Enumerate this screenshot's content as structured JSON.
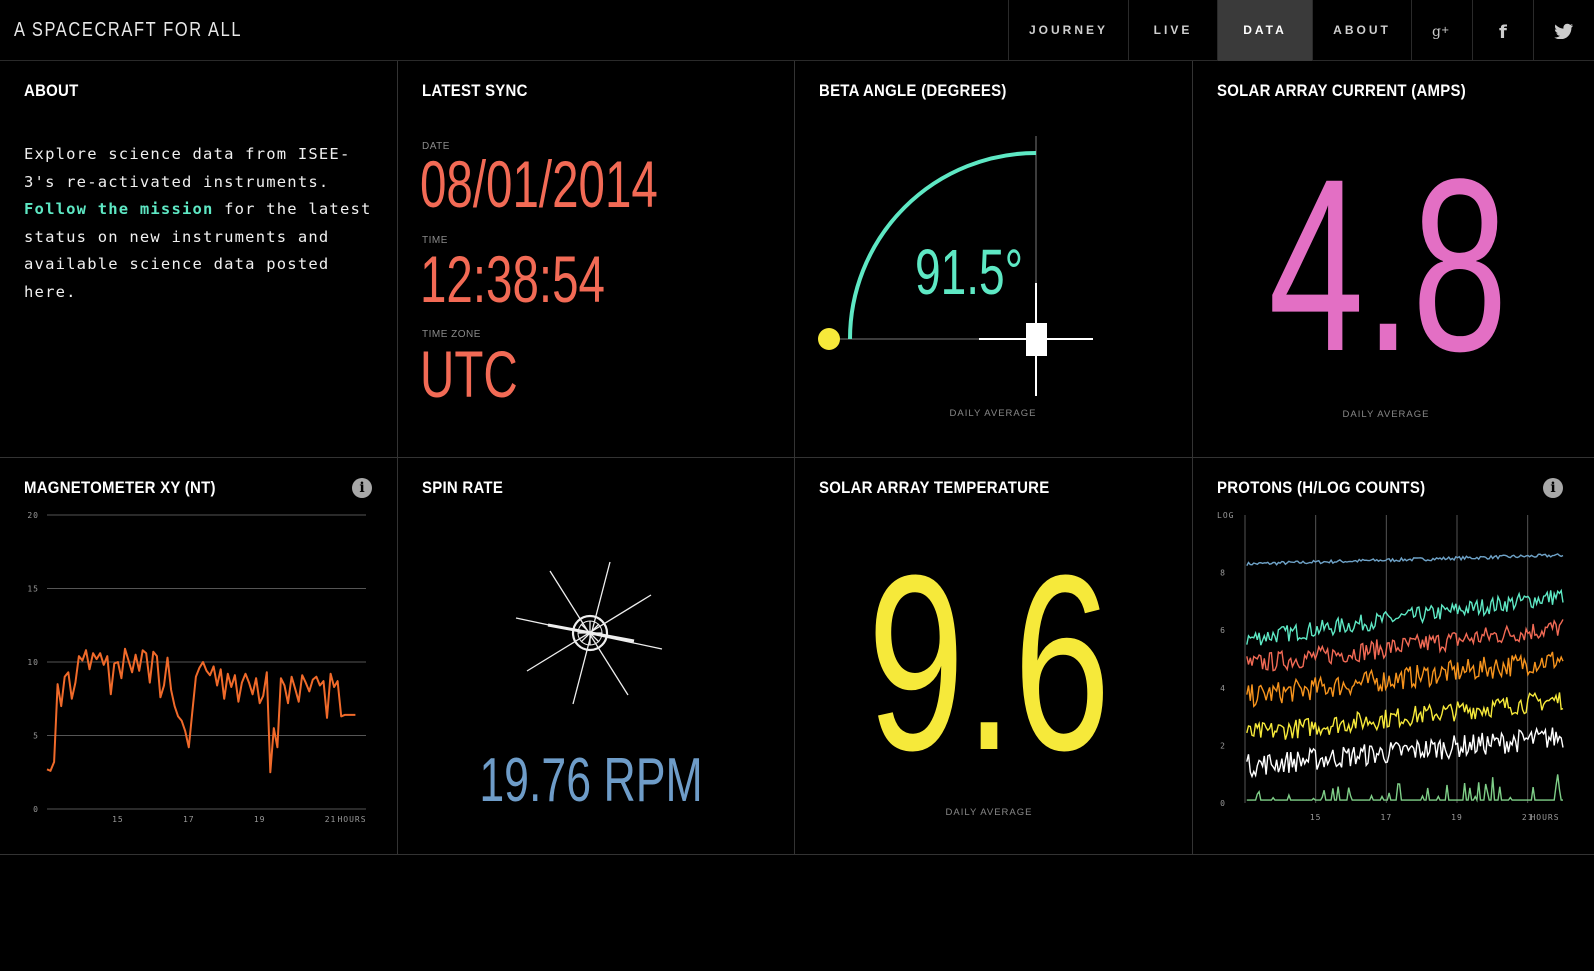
{
  "header": {
    "brand": "A SPACECRAFT FOR ALL",
    "nav": [
      {
        "label": "JOURNEY",
        "active": false
      },
      {
        "label": "LIVE",
        "active": false
      },
      {
        "label": "DATA",
        "active": true
      },
      {
        "label": "ABOUT",
        "active": false
      }
    ],
    "social": [
      "google-plus-icon",
      "facebook-icon",
      "twitter-icon"
    ]
  },
  "about": {
    "title": "ABOUT",
    "text_1": "Explore science data from ISEE-3's re-activated instruments.",
    "link": "Follow the mission",
    "text_2": " for the latest status on new instruments and available science data posted here."
  },
  "sync": {
    "title": "LATEST SYNC",
    "date_label": "DATE",
    "date": "08/01/2014",
    "time_label": "TIME",
    "time": "12:38:54",
    "tz_label": "TIME ZONE",
    "tz": "UTC"
  },
  "beta": {
    "title": "BETA ANGLE (DEGREES)",
    "value": "91.5°",
    "degrees": 91.5,
    "note": "DAILY AVERAGE"
  },
  "solar_current": {
    "title": "SOLAR ARRAY CURRENT (AMPS)",
    "value": "4.8",
    "note": "DAILY AVERAGE"
  },
  "magnetometer": {
    "title": "MAGNETOMETER XY (NT)",
    "info": "i"
  },
  "spin": {
    "title": "SPIN RATE",
    "value": "19.76 RPM"
  },
  "solar_temp": {
    "title": "SOLAR ARRAY TEMPERATURE",
    "value": "9.6",
    "note": "DAILY AVERAGE"
  },
  "protons": {
    "title": "PROTONS (H/LOG COUNTS)",
    "info": "i"
  },
  "colors": {
    "teal": "#5ee8c4",
    "red": "#f26a55",
    "pink": "#e36fc4",
    "yellow": "#f6e93a",
    "blue": "#6e9cc8",
    "orange": "#f06a2a"
  },
  "chart_data": [
    {
      "type": "line",
      "xlabel": "HOURS",
      "ylabel": "",
      "xticks": [
        "15",
        "17",
        "19",
        "21"
      ],
      "yticks": [
        "0",
        "5",
        "10",
        "15",
        "20"
      ],
      "ylim": [
        0,
        20
      ],
      "xlim": [
        13,
        22
      ],
      "grid": true,
      "series": [
        {
          "color": "#f06a2a",
          "x": [
            13.0,
            13.1,
            13.2,
            13.3,
            13.4,
            13.5,
            13.6,
            13.7,
            13.8,
            13.9,
            14.0,
            14.1,
            14.2,
            14.3,
            14.4,
            14.5,
            14.6,
            14.7,
            14.8,
            14.9,
            15.0,
            15.1,
            15.2,
            15.3,
            15.4,
            15.5,
            15.6,
            15.7,
            15.8,
            15.9,
            16.0,
            16.1,
            16.2,
            16.3,
            16.4,
            16.5,
            16.6,
            16.7,
            16.8,
            16.9,
            17.0,
            17.1,
            17.2,
            17.3,
            17.4,
            17.5,
            17.6,
            17.7,
            17.8,
            17.9,
            18.0,
            18.1,
            18.2,
            18.3,
            18.4,
            18.5,
            18.6,
            18.7,
            18.8,
            18.9,
            19.0,
            19.1,
            19.2,
            19.3,
            19.4,
            19.5,
            19.6,
            19.7,
            19.8,
            19.9,
            20.0,
            20.1,
            20.2,
            20.3,
            20.4,
            20.5,
            20.6,
            20.7,
            20.8,
            20.9,
            21.0,
            21.1,
            21.2,
            21.3,
            21.4,
            21.5,
            21.6,
            21.7
          ],
          "values": [
            2.7,
            2.6,
            3.2,
            8.5,
            7.0,
            9.0,
            9.3,
            7.5,
            8.6,
            10.4,
            10.1,
            10.8,
            9.5,
            10.6,
            10.2,
            10.6,
            9.8,
            10.4,
            7.8,
            9.9,
            10.0,
            8.9,
            10.9,
            10.1,
            9.3,
            10.5,
            9.4,
            10.8,
            10.6,
            8.6,
            10.7,
            10.4,
            7.6,
            8.4,
            10.3,
            8.1,
            7.0,
            6.3,
            6.0,
            5.3,
            4.2,
            6.6,
            9.0,
            9.6,
            10.0,
            9.4,
            9.1,
            9.7,
            8.4,
            9.5,
            7.5,
            9.2,
            8.3,
            9.1,
            7.3,
            8.6,
            9.2,
            8.6,
            7.8,
            8.9,
            7.2,
            7.7,
            9.3,
            2.5,
            5.5,
            4.2,
            8.9,
            8.4,
            7.2,
            9.0,
            8.2,
            7.3,
            9.1,
            8.6,
            8.0,
            8.8,
            9.0,
            8.4,
            8.7,
            6.2,
            9.2,
            8.3,
            8.7,
            6.3,
            6.4,
            6.4,
            6.4,
            6.4
          ]
        }
      ]
    },
    {
      "type": "line",
      "xlabel": "HOURS",
      "ylabel": "LOG",
      "xticks": [
        "15",
        "17",
        "19",
        "21"
      ],
      "yticks": [
        "0",
        "2",
        "4",
        "6",
        "8"
      ],
      "ylim": [
        0,
        10
      ],
      "xlim": [
        13,
        22
      ],
      "grid": true,
      "series": [
        {
          "color": "#6fa3c8",
          "start": 8.3,
          "end": 8.6,
          "noise": 0.06
        },
        {
          "color": "#5ee8c4",
          "start": 5.7,
          "end": 7.2,
          "noise": 0.3
        },
        {
          "color": "#f26a55",
          "start": 4.8,
          "end": 6.1,
          "noise": 0.35
        },
        {
          "color": "#f7941d",
          "start": 3.7,
          "end": 5.0,
          "noise": 0.4
        },
        {
          "color": "#f6e93a",
          "start": 2.4,
          "end": 3.6,
          "noise": 0.35
        },
        {
          "color": "#ffffff",
          "start": 1.3,
          "end": 2.3,
          "noise": 0.4
        },
        {
          "color": "#7fcf88",
          "start": 0.1,
          "end": 0.4,
          "noise": 0.35
        }
      ]
    }
  ]
}
